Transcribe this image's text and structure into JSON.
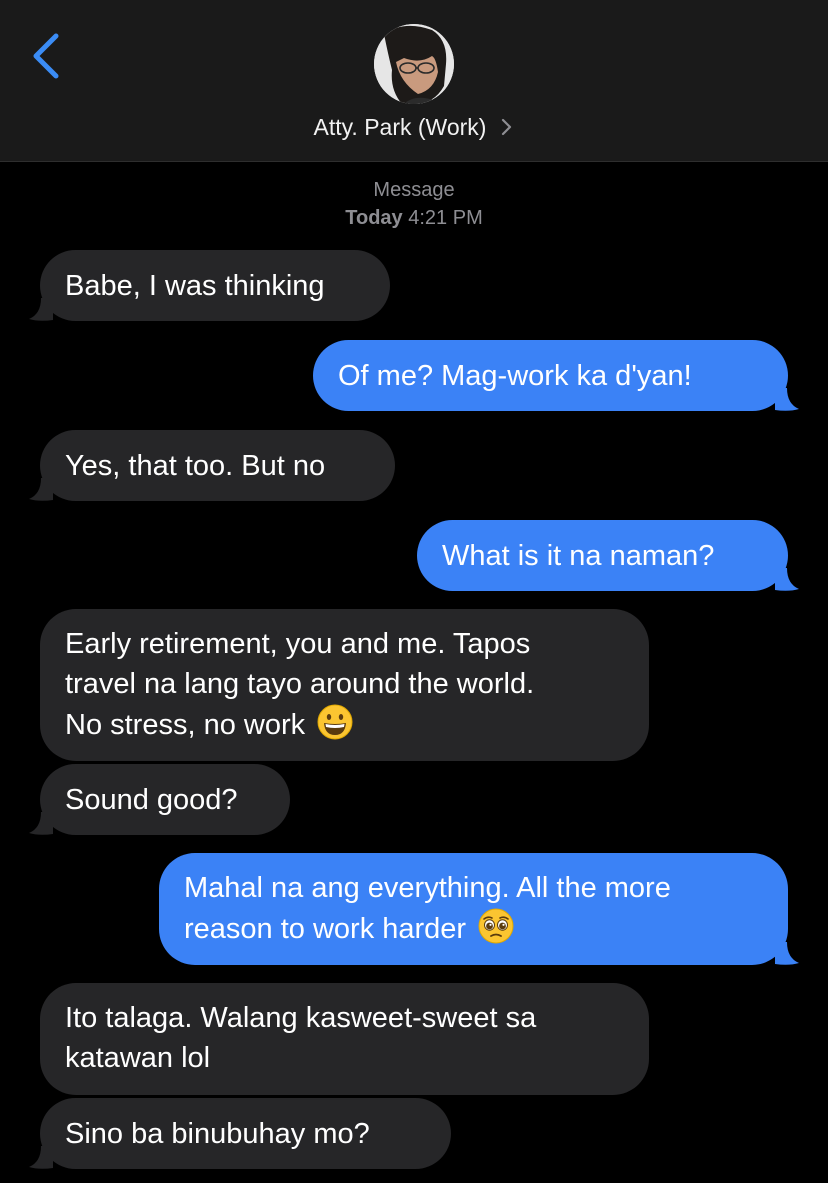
{
  "header": {
    "contact_name": "Atty. Park (Work)"
  },
  "thread": {
    "service_label": "Message",
    "day_label": "Today",
    "time_label": "4:21 PM"
  },
  "messages": [
    {
      "from": "them",
      "text": "Babe, I was thinking"
    },
    {
      "from": "me",
      "text": "Of me? Mag-work ka d'yan!"
    },
    {
      "from": "them",
      "text": "Yes, that too. But no"
    },
    {
      "from": "me",
      "text": "What is it na naman?"
    },
    {
      "from": "them",
      "lines": [
        "Early retirement, you and me. Tapos",
        "travel na lang tayo around the world.",
        "No stress, no work"
      ],
      "emoji": "grinning-face"
    },
    {
      "from": "them",
      "text": "Sound good?"
    },
    {
      "from": "me",
      "lines": [
        "Mahal na ang everything. All the more",
        "reason to work harder"
      ],
      "emoji": "pleading-face"
    },
    {
      "from": "them",
      "lines": [
        "Ito talaga. Walang kasweet-sweet sa",
        "katawan lol"
      ]
    },
    {
      "from": "them",
      "text": "Sino ba binubuhay mo?"
    }
  ],
  "colors": {
    "sent_bubble": "#3b82f6",
    "received_bubble": "#262628",
    "accent": "#3b8cf5"
  }
}
